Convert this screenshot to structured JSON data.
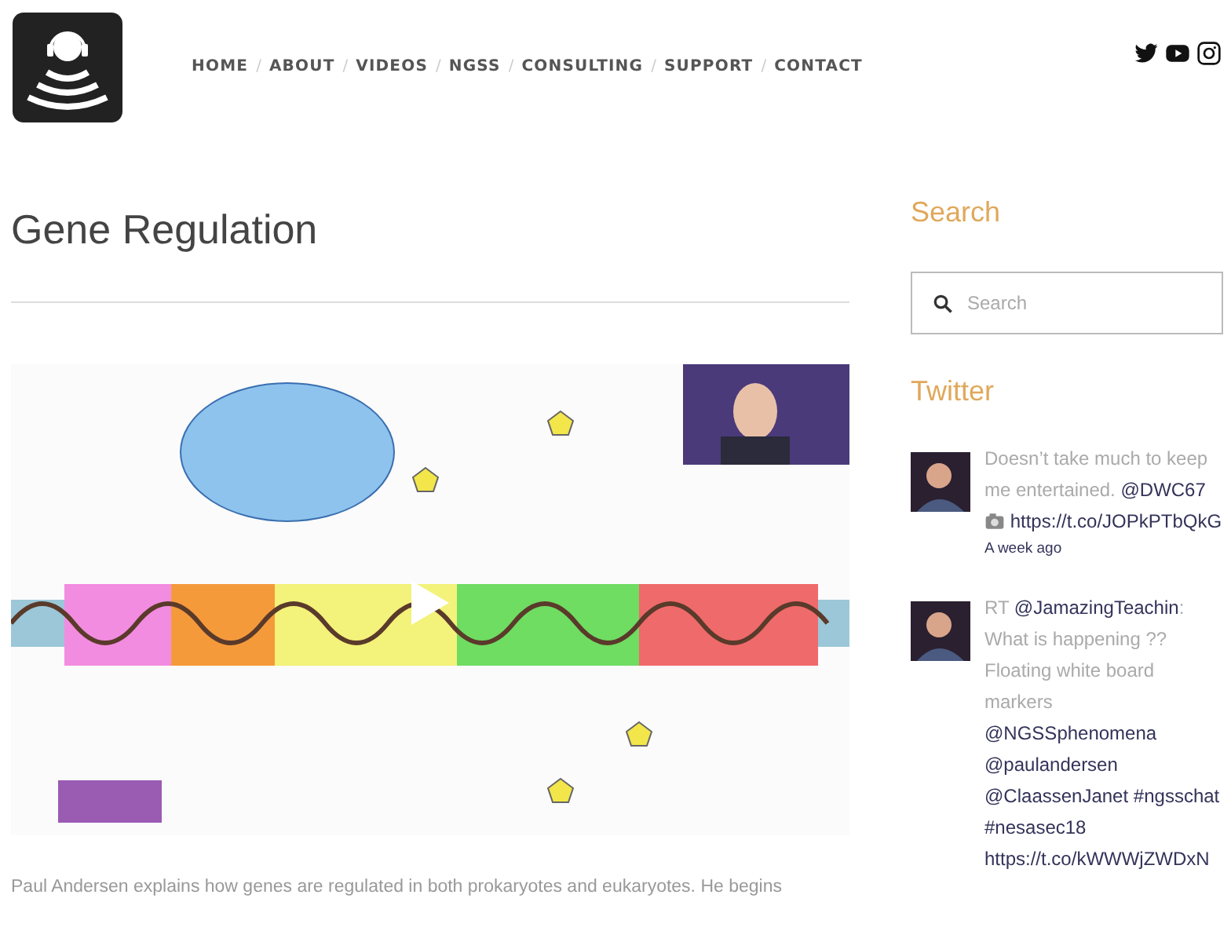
{
  "nav": [
    {
      "label": "HOME",
      "selected": false
    },
    {
      "label": "ABOUT",
      "selected": false
    },
    {
      "label": "VIDEOS",
      "selected": false
    },
    {
      "label": "NGSS",
      "selected": false
    },
    {
      "label": "CONSULTING",
      "selected": false
    },
    {
      "label": "SUPPORT",
      "selected": false
    },
    {
      "label": "CONTACT",
      "selected": false
    }
  ],
  "nav_separator": "/",
  "social": [
    {
      "kind": "twitter"
    },
    {
      "kind": "youtube"
    },
    {
      "kind": "instagram"
    }
  ],
  "article": {
    "title": "Gene Regulation",
    "video": {
      "play": true
    },
    "description": "Paul Andersen explains how genes are regulated in both prokaryotes and eukaryotes. He begins"
  },
  "sidebar": {
    "search_title": "Search",
    "search": {
      "placeholder": "Search"
    },
    "twitter_title": "Twitter",
    "tweets": [
      {
        "parts": [
          {
            "kind": "text",
            "text": "Doesn’t take much to keep me entertained."
          },
          {
            "kind": "link",
            "text": "@DWC67"
          },
          {
            "kind": "camera"
          },
          {
            "kind": "link",
            "text": "https://t.co/JOPkPTbQkG"
          }
        ],
        "time": "A week ago"
      },
      {
        "parts": [
          {
            "kind": "text",
            "text": "RT"
          },
          {
            "kind": "link",
            "text": "@JamazingTeachin"
          },
          {
            "kind": "text",
            "joined": true,
            "text": ": What is happening ?? Floating white board markers"
          },
          {
            "kind": "link",
            "text": "@NGSSphenomena"
          },
          {
            "kind": "link",
            "text": "@paulandersen"
          },
          {
            "kind": "link",
            "text": "@ClaassenJanet"
          },
          {
            "kind": "link",
            "text": "#ngsschat"
          },
          {
            "kind": "link",
            "text": "#nesasec18"
          },
          {
            "kind": "link",
            "text": "https://t.co/kWWWjZWDxN"
          }
        ]
      }
    ]
  }
}
